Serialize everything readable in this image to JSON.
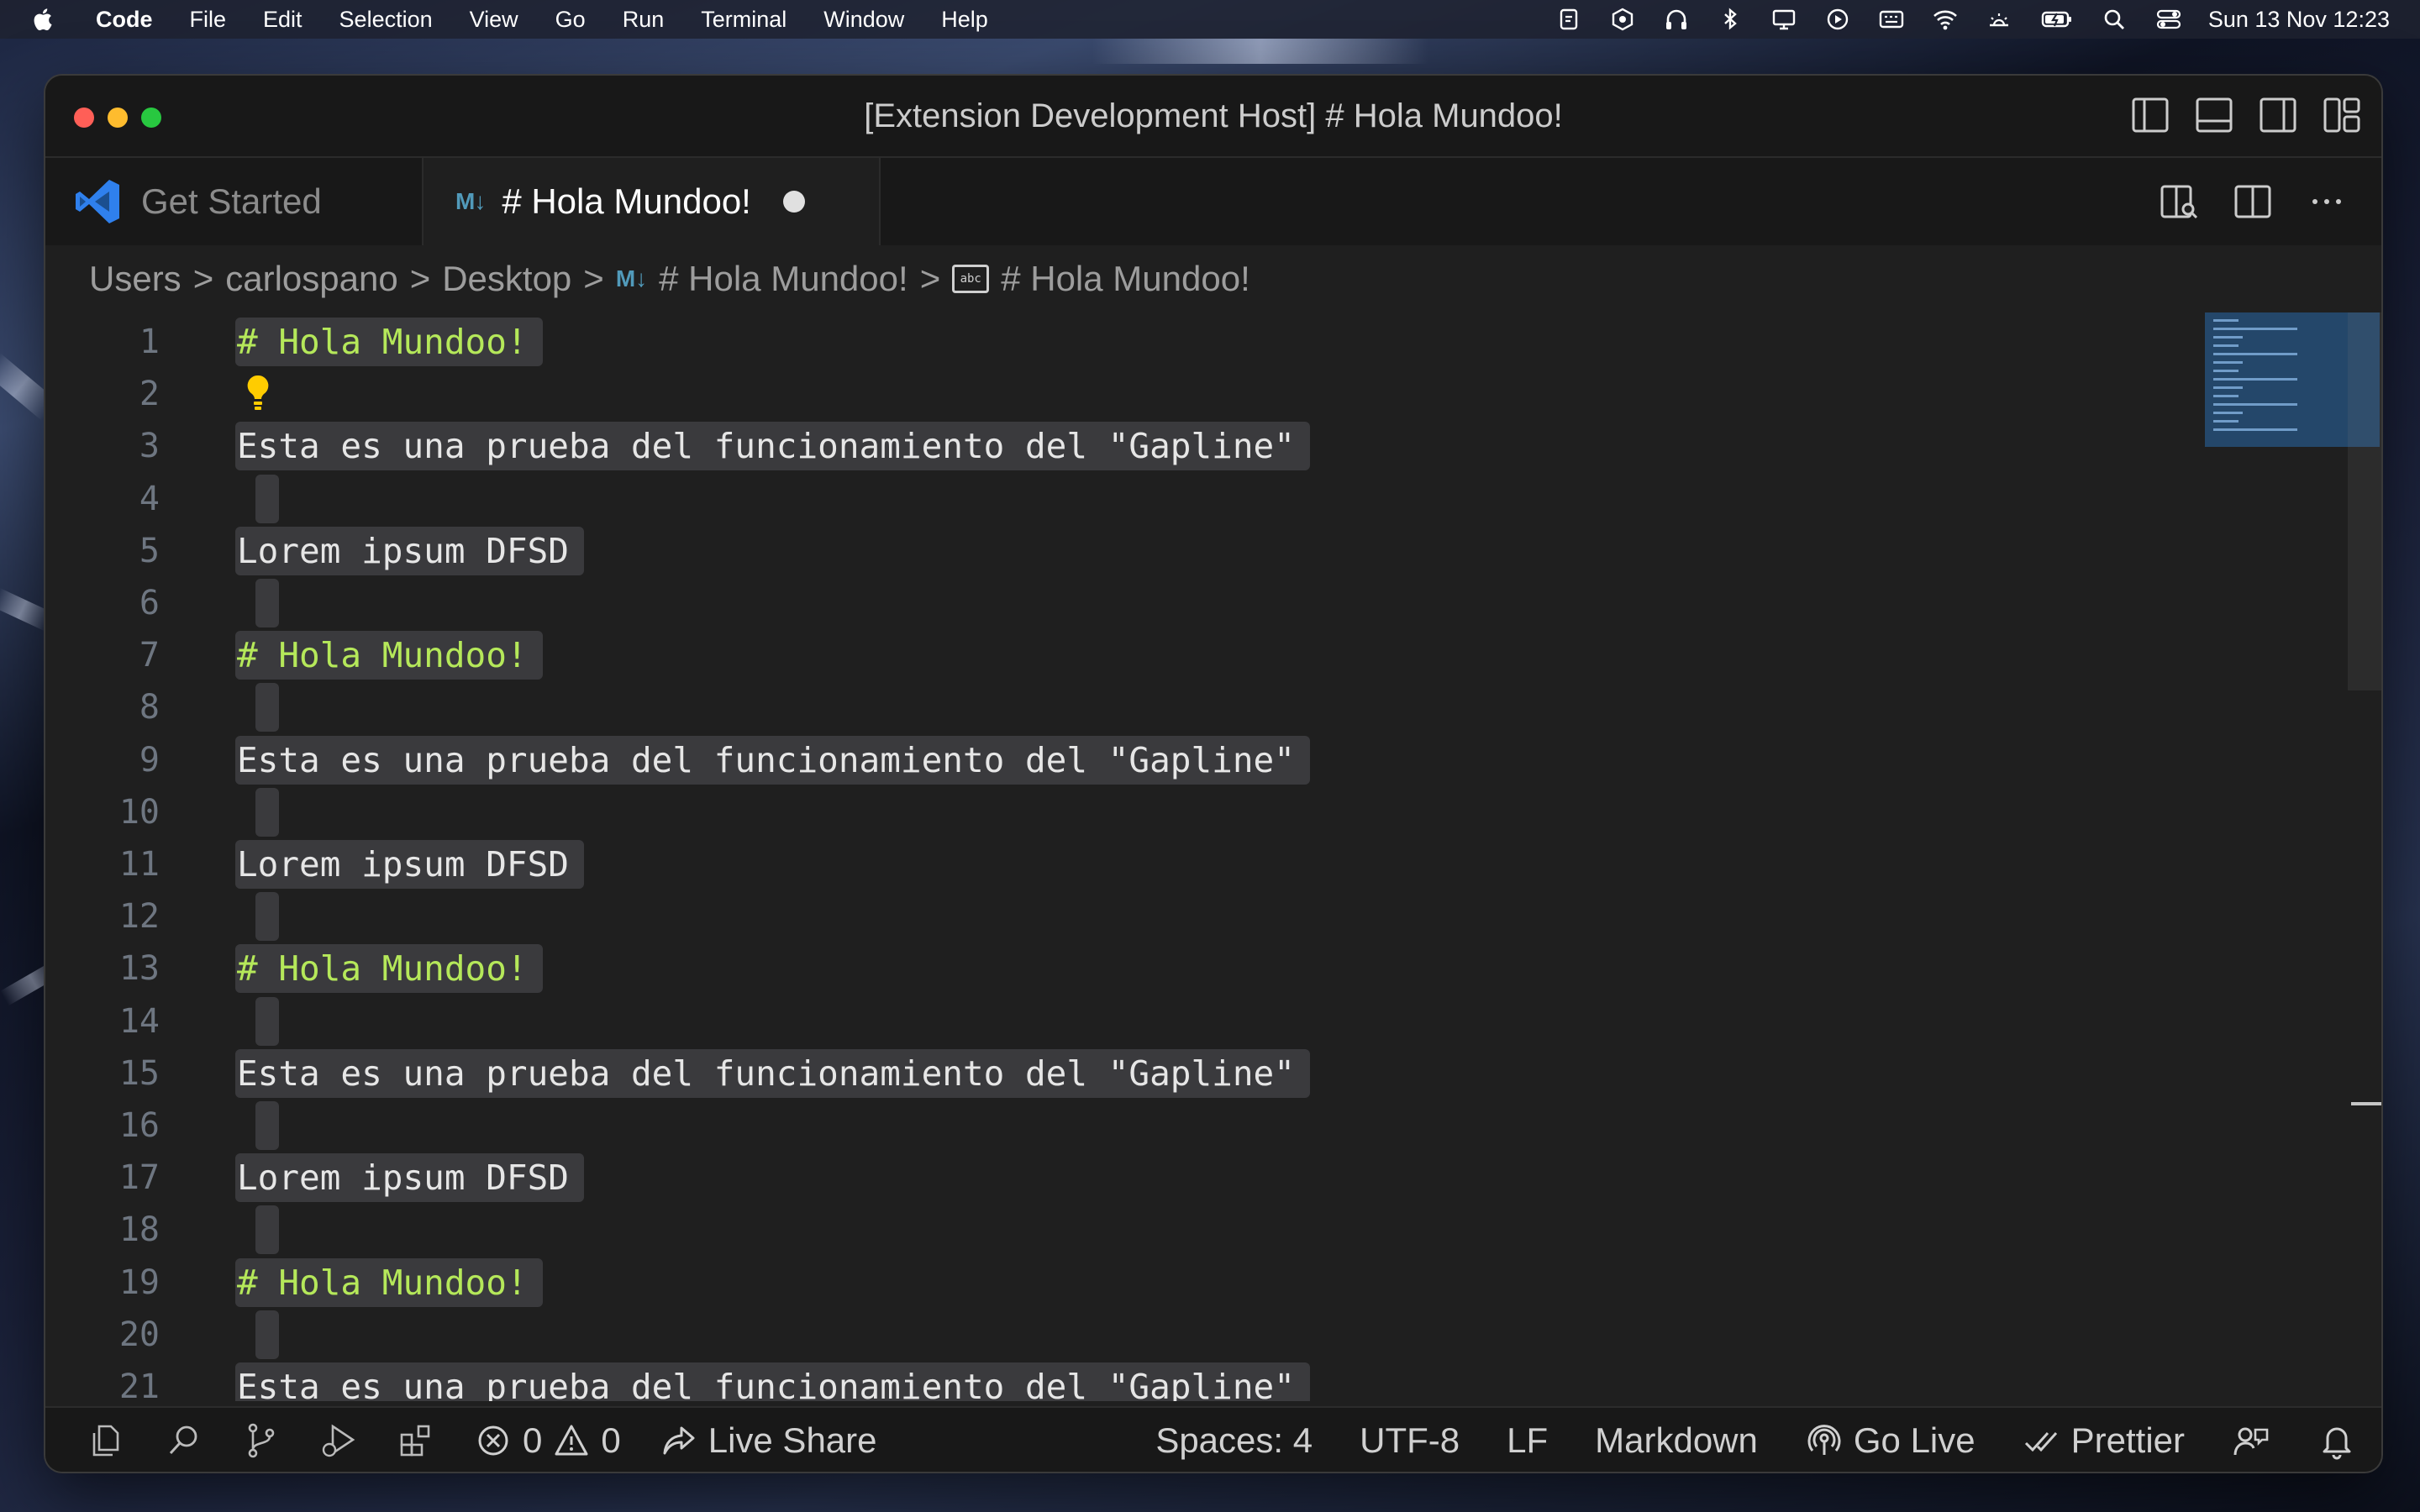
{
  "menubar": {
    "app": "Code",
    "items": [
      "File",
      "Edit",
      "Selection",
      "View",
      "Go",
      "Run",
      "Terminal",
      "Window",
      "Help"
    ],
    "clock": "Sun 13 Nov  12:23"
  },
  "window": {
    "title": "[Extension Development Host] # Hola Mundoo!"
  },
  "tabs": [
    {
      "label": "Get Started",
      "active": false
    },
    {
      "label": "# Hola Mundoo!",
      "active": true,
      "icon": "M↓",
      "dirty": true
    }
  ],
  "breadcrumb": {
    "segments": [
      "Users",
      "carlospano",
      "Desktop"
    ],
    "file_icon": "M↓",
    "file": "# Hola Mundoo!",
    "symbol_icon": "abc",
    "symbol": "# Hola Mundoo!"
  },
  "editor": {
    "lines": [
      {
        "n": "1",
        "text": "# Hola Mundoo!",
        "type": "heading"
      },
      {
        "n": "2",
        "text": "",
        "type": "bulb"
      },
      {
        "n": "3",
        "text": "Esta es una prueba del funcionamiento del \"Gapline\"",
        "type": "text"
      },
      {
        "n": "4",
        "text": "",
        "type": "empty"
      },
      {
        "n": "5",
        "text": "Lorem ipsum DFSD",
        "type": "text"
      },
      {
        "n": "6",
        "text": "",
        "type": "empty"
      },
      {
        "n": "7",
        "text": "# Hola Mundoo!",
        "type": "heading"
      },
      {
        "n": "8",
        "text": "",
        "type": "empty"
      },
      {
        "n": "9",
        "text": "Esta es una prueba del funcionamiento del \"Gapline\"",
        "type": "text"
      },
      {
        "n": "10",
        "text": "",
        "type": "empty"
      },
      {
        "n": "11",
        "text": "Lorem ipsum DFSD",
        "type": "text"
      },
      {
        "n": "12",
        "text": "",
        "type": "empty"
      },
      {
        "n": "13",
        "text": "# Hola Mundoo!",
        "type": "heading"
      },
      {
        "n": "14",
        "text": "",
        "type": "empty"
      },
      {
        "n": "15",
        "text": "Esta es una prueba del funcionamiento del \"Gapline\"",
        "type": "text"
      },
      {
        "n": "16",
        "text": "",
        "type": "empty"
      },
      {
        "n": "17",
        "text": "Lorem ipsum DFSD",
        "type": "text"
      },
      {
        "n": "18",
        "text": "",
        "type": "empty"
      },
      {
        "n": "19",
        "text": "# Hola Mundoo!",
        "type": "heading"
      },
      {
        "n": "20",
        "text": "",
        "type": "empty"
      },
      {
        "n": "21",
        "text": "Esta es una prueba del funcionamiento del \"Gapline\"",
        "type": "text"
      }
    ]
  },
  "statusbar": {
    "errors": "0",
    "warnings": "0",
    "live_share": "Live Share",
    "spaces": "Spaces: 4",
    "encoding": "UTF-8",
    "eol": "LF",
    "language": "Markdown",
    "go_live": "Go Live",
    "prettier": "Prettier"
  },
  "colors": {
    "heading": "#b5e85a",
    "selection": "#3a3a3d",
    "md_icon": "#519aba"
  }
}
